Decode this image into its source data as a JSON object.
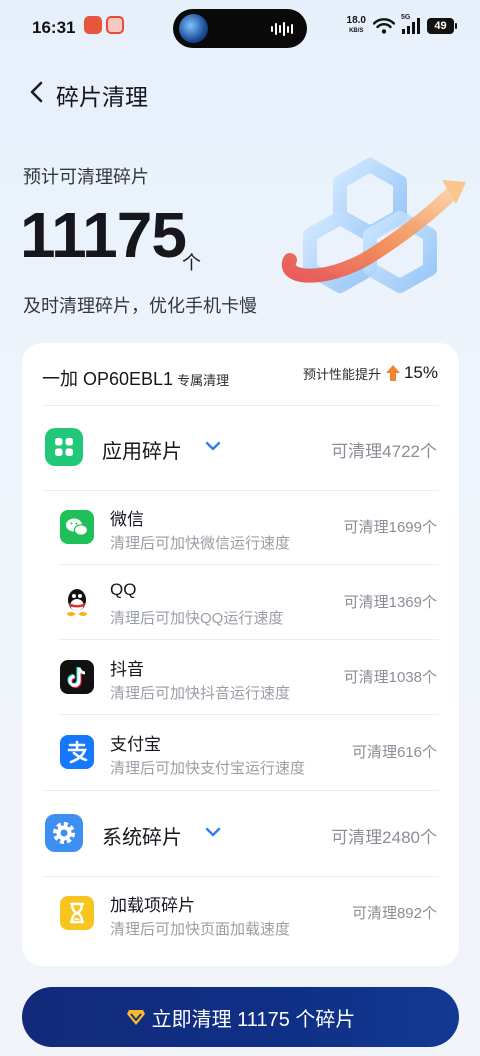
{
  "status_bar": {
    "time": "16:31",
    "net_speed": "18.0",
    "net_unit": "KB/S",
    "net_type": "5G",
    "battery": "49"
  },
  "header": {
    "title": "碎片清理"
  },
  "hero": {
    "label": "预计可清理碎片",
    "count": "11175",
    "unit": "个",
    "description": "及时清理碎片，优化手机卡慢"
  },
  "card": {
    "device_name": "一加 OP60EBL1",
    "device_sub": "专属清理",
    "perf_label": "预计性能提升",
    "perf_value": "15%",
    "categories": [
      {
        "label": "应用碎片",
        "amount": "可清理4722个",
        "icon": "app-grid-icon",
        "items": [
          {
            "name": "微信",
            "desc": "清理后可加快微信运行速度",
            "amount": "可清理1699个",
            "icon": "wechat-icon"
          },
          {
            "name": "QQ",
            "desc": "清理后可加快QQ运行速度",
            "amount": "可清理1369个",
            "icon": "qq-icon"
          },
          {
            "name": "抖音",
            "desc": "清理后可加快抖音运行速度",
            "amount": "可清理1038个",
            "icon": "douyin-icon"
          },
          {
            "name": "支付宝",
            "desc": "清理后可加快支付宝运行速度",
            "amount": "可清理616个",
            "icon": "alipay-icon"
          }
        ]
      },
      {
        "label": "系统碎片",
        "amount": "可清理2480个",
        "icon": "gear-icon",
        "items": [
          {
            "name": "加载项碎片",
            "desc": "清理后可加快页面加载速度",
            "amount": "可清理892个",
            "icon": "hourglass-icon"
          }
        ]
      }
    ]
  },
  "bottom_button": {
    "label": "立即清理 11175 个碎片"
  },
  "colors": {
    "primary_button": "#132a7a",
    "accent_blue": "#2f7fe8",
    "app_green": "#22c77a"
  }
}
